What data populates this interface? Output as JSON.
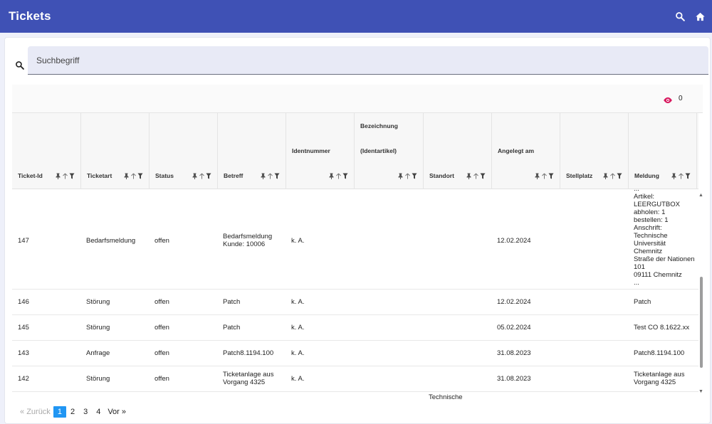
{
  "app": {
    "title": "Tickets"
  },
  "search": {
    "placeholder": "Suchbegriff"
  },
  "toolbar": {
    "hidden_count": "0"
  },
  "columns": [
    {
      "key": "ticket_id",
      "label": "Ticket-Id"
    },
    {
      "key": "ticketart",
      "label": "Ticketart"
    },
    {
      "key": "status",
      "label": "Status"
    },
    {
      "key": "betreff",
      "label": "Betreff"
    },
    {
      "key": "identnummer",
      "label": "Identnummer"
    },
    {
      "key": "bezeichnung",
      "label": "Bezeichnung",
      "label2": "(Identartikel)"
    },
    {
      "key": "standort",
      "label": "Standort"
    },
    {
      "key": "angelegt_am",
      "label": "Angelegt am"
    },
    {
      "key": "stellplatz",
      "label": "Stellplatz"
    },
    {
      "key": "meldung",
      "label": "Meldung"
    }
  ],
  "rows": [
    {
      "ticket_id": "147",
      "ticketart": "Bedarfsmeldung",
      "status": "offen",
      "betreff": "Bedarfsmeldung Kunde: 10006",
      "identnummer": "k. A.",
      "angelegt_am": "12.02.2024",
      "meldung": "...\nArtikel:\nLEERGUTBOX\nabholen: 1\nbestellen: 1\nAnschrift:\nTechnische\nUniversität\nChemnitz\nStraße der Nationen\n101\n09111 Chemnitz\n..."
    },
    {
      "ticket_id": "146",
      "ticketart": "Störung",
      "status": "offen",
      "betreff": "Patch",
      "identnummer": "k. A.",
      "angelegt_am": "12.02.2024",
      "meldung": "Patch"
    },
    {
      "ticket_id": "145",
      "ticketart": "Störung",
      "status": "offen",
      "betreff": "Patch",
      "identnummer": "k. A.",
      "angelegt_am": "05.02.2024",
      "meldung": "Test CO 8.1622.xx"
    },
    {
      "ticket_id": "143",
      "ticketart": "Anfrage",
      "status": "offen",
      "betreff": "Patch8.1194.100",
      "identnummer": "k. A.",
      "angelegt_am": "31.08.2023",
      "meldung": "Patch8.1194.100"
    },
    {
      "ticket_id": "142",
      "ticketart": "Störung",
      "status": "offen",
      "betreff": "Ticketanlage aus Vorgang 4325",
      "identnummer": "k. A.",
      "angelegt_am": "31.08.2023",
      "meldung": "Ticketanlage aus Vorgang 4325"
    },
    {
      "standort": "Technische"
    }
  ],
  "pagination": {
    "prev": "Zurück",
    "pages": [
      "1",
      "2",
      "3",
      "4"
    ],
    "next": "Vor"
  },
  "colors": {
    "appbar": "#3f51b5",
    "accent": "#2196f3",
    "eye": "#d81b60"
  }
}
